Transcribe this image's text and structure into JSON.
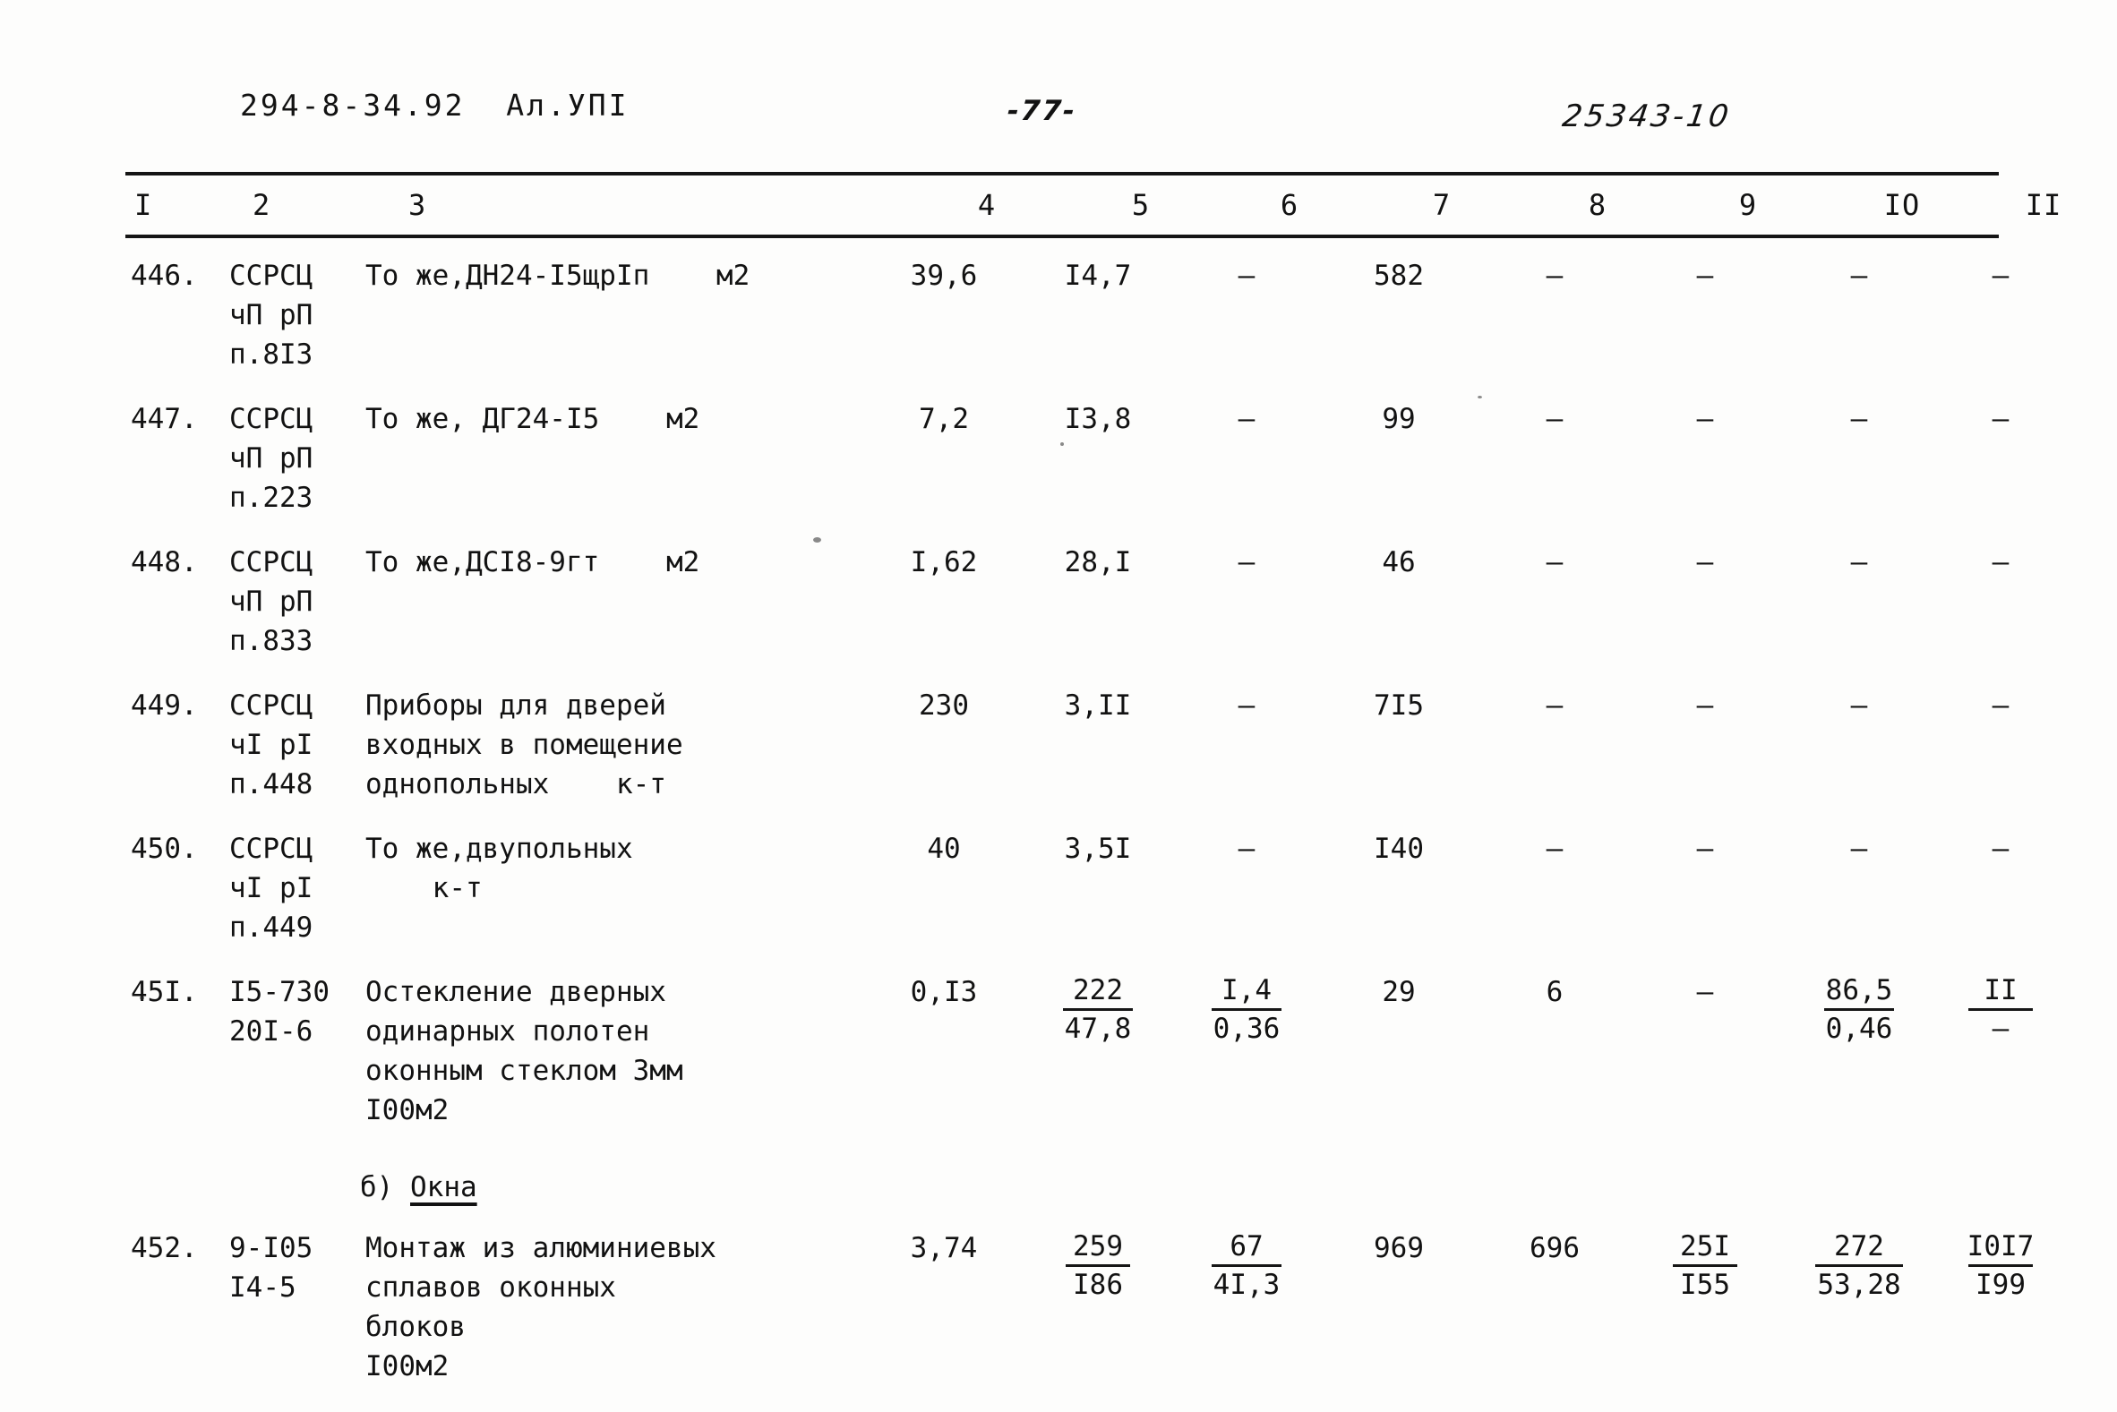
{
  "header": {
    "left": "294-8-34.92  Ал.УПI",
    "page_number": "-77-",
    "stamp": "25343-10"
  },
  "table": {
    "column_headers": [
      "I",
      "2",
      "3",
      "4",
      "5",
      "6",
      "7",
      "8",
      "9",
      "IO",
      "II"
    ],
    "rows": [
      {
        "num": "446.",
        "code_lines": [
          "ССРСЦ",
          "чП рП",
          "п.8I3"
        ],
        "desc_lines": [
          "То же,ДН24-I5щрIп"
        ],
        "unit": "м2",
        "c4": "39,6",
        "c5": "I4,7",
        "c6": "–",
        "c7": "582",
        "c8": "–",
        "c9": "–",
        "c10": "–",
        "c11": "–"
      },
      {
        "num": "447.",
        "code_lines": [
          "ССРСЦ",
          "чП рП",
          "п.223"
        ],
        "desc_lines": [
          "То же, ДГ24-I5"
        ],
        "unit": "м2",
        "c4": "7,2",
        "c5": "I3,8",
        "c6": "–",
        "c7": "99",
        "c8": "–",
        "c9": "–",
        "c10": "–",
        "c11": "–"
      },
      {
        "num": "448.",
        "code_lines": [
          "ССРСЦ",
          "чП рП",
          "п.833"
        ],
        "desc_lines": [
          "То же,ДСI8-9гт"
        ],
        "unit": "м2",
        "c4": "I,62",
        "c5": "28,I",
        "c6": "–",
        "c7": "46",
        "c8": "–",
        "c9": "–",
        "c10": "–",
        "c11": "–"
      },
      {
        "num": "449.",
        "code_lines": [
          "ССРСЦ",
          "чI рI",
          "п.448"
        ],
        "desc_lines": [
          "Приборы для дверей",
          "входных в помещение",
          "однопольных"
        ],
        "unit": "к-т",
        "c4": "230",
        "c5": "3,II",
        "c6": "–",
        "c7": "7I5",
        "c8": "–",
        "c9": "–",
        "c10": "–",
        "c11": "–"
      },
      {
        "num": "450.",
        "code_lines": [
          "ССРСЦ",
          "чI рI",
          "п.449"
        ],
        "desc_lines": [
          "То же,двупольных",
          ""
        ],
        "unit": "к-т",
        "c4": "40",
        "c5": "3,5I",
        "c6": "–",
        "c7": "I40",
        "c8": "–",
        "c9": "–",
        "c10": "–",
        "c11": "–"
      },
      {
        "num": "45I.",
        "code_lines": [
          "I5-730",
          "20I-6"
        ],
        "desc_lines": [
          "Остекление дверных",
          "одинарных полотен",
          "оконным стеклом 3мм"
        ],
        "unit": "I00м2",
        "c4": "0,I3",
        "c5": {
          "top": "222",
          "bot": "47,8"
        },
        "c6": {
          "top": "I,4",
          "bot": "0,36"
        },
        "c7": "29",
        "c8": "6",
        "c9": "–",
        "c10": {
          "top": "86,5",
          "bot": "0,46"
        },
        "c11": {
          "top": "II",
          "bot": "–"
        }
      },
      {
        "num": "452.",
        "code_lines": [
          "9-I05",
          "I4-5"
        ],
        "desc_lines": [
          "Монтаж из алюминиевых",
          "сплавов оконных",
          "блоков"
        ],
        "unit": "I00м2",
        "c4": "3,74",
        "c5": {
          "top": "259",
          "bot": "I86"
        },
        "c6": {
          "top": "67",
          "bot": "4I,3"
        },
        "c7": "969",
        "c8": "696",
        "c9": {
          "top": "25I",
          "bot": "I55"
        },
        "c10": {
          "top": "272",
          "bot": "53,28"
        },
        "c11": {
          "top": "I0I7",
          "bot": "I99"
        }
      }
    ],
    "subheading": {
      "marker": "б)",
      "text": "Окна"
    }
  }
}
